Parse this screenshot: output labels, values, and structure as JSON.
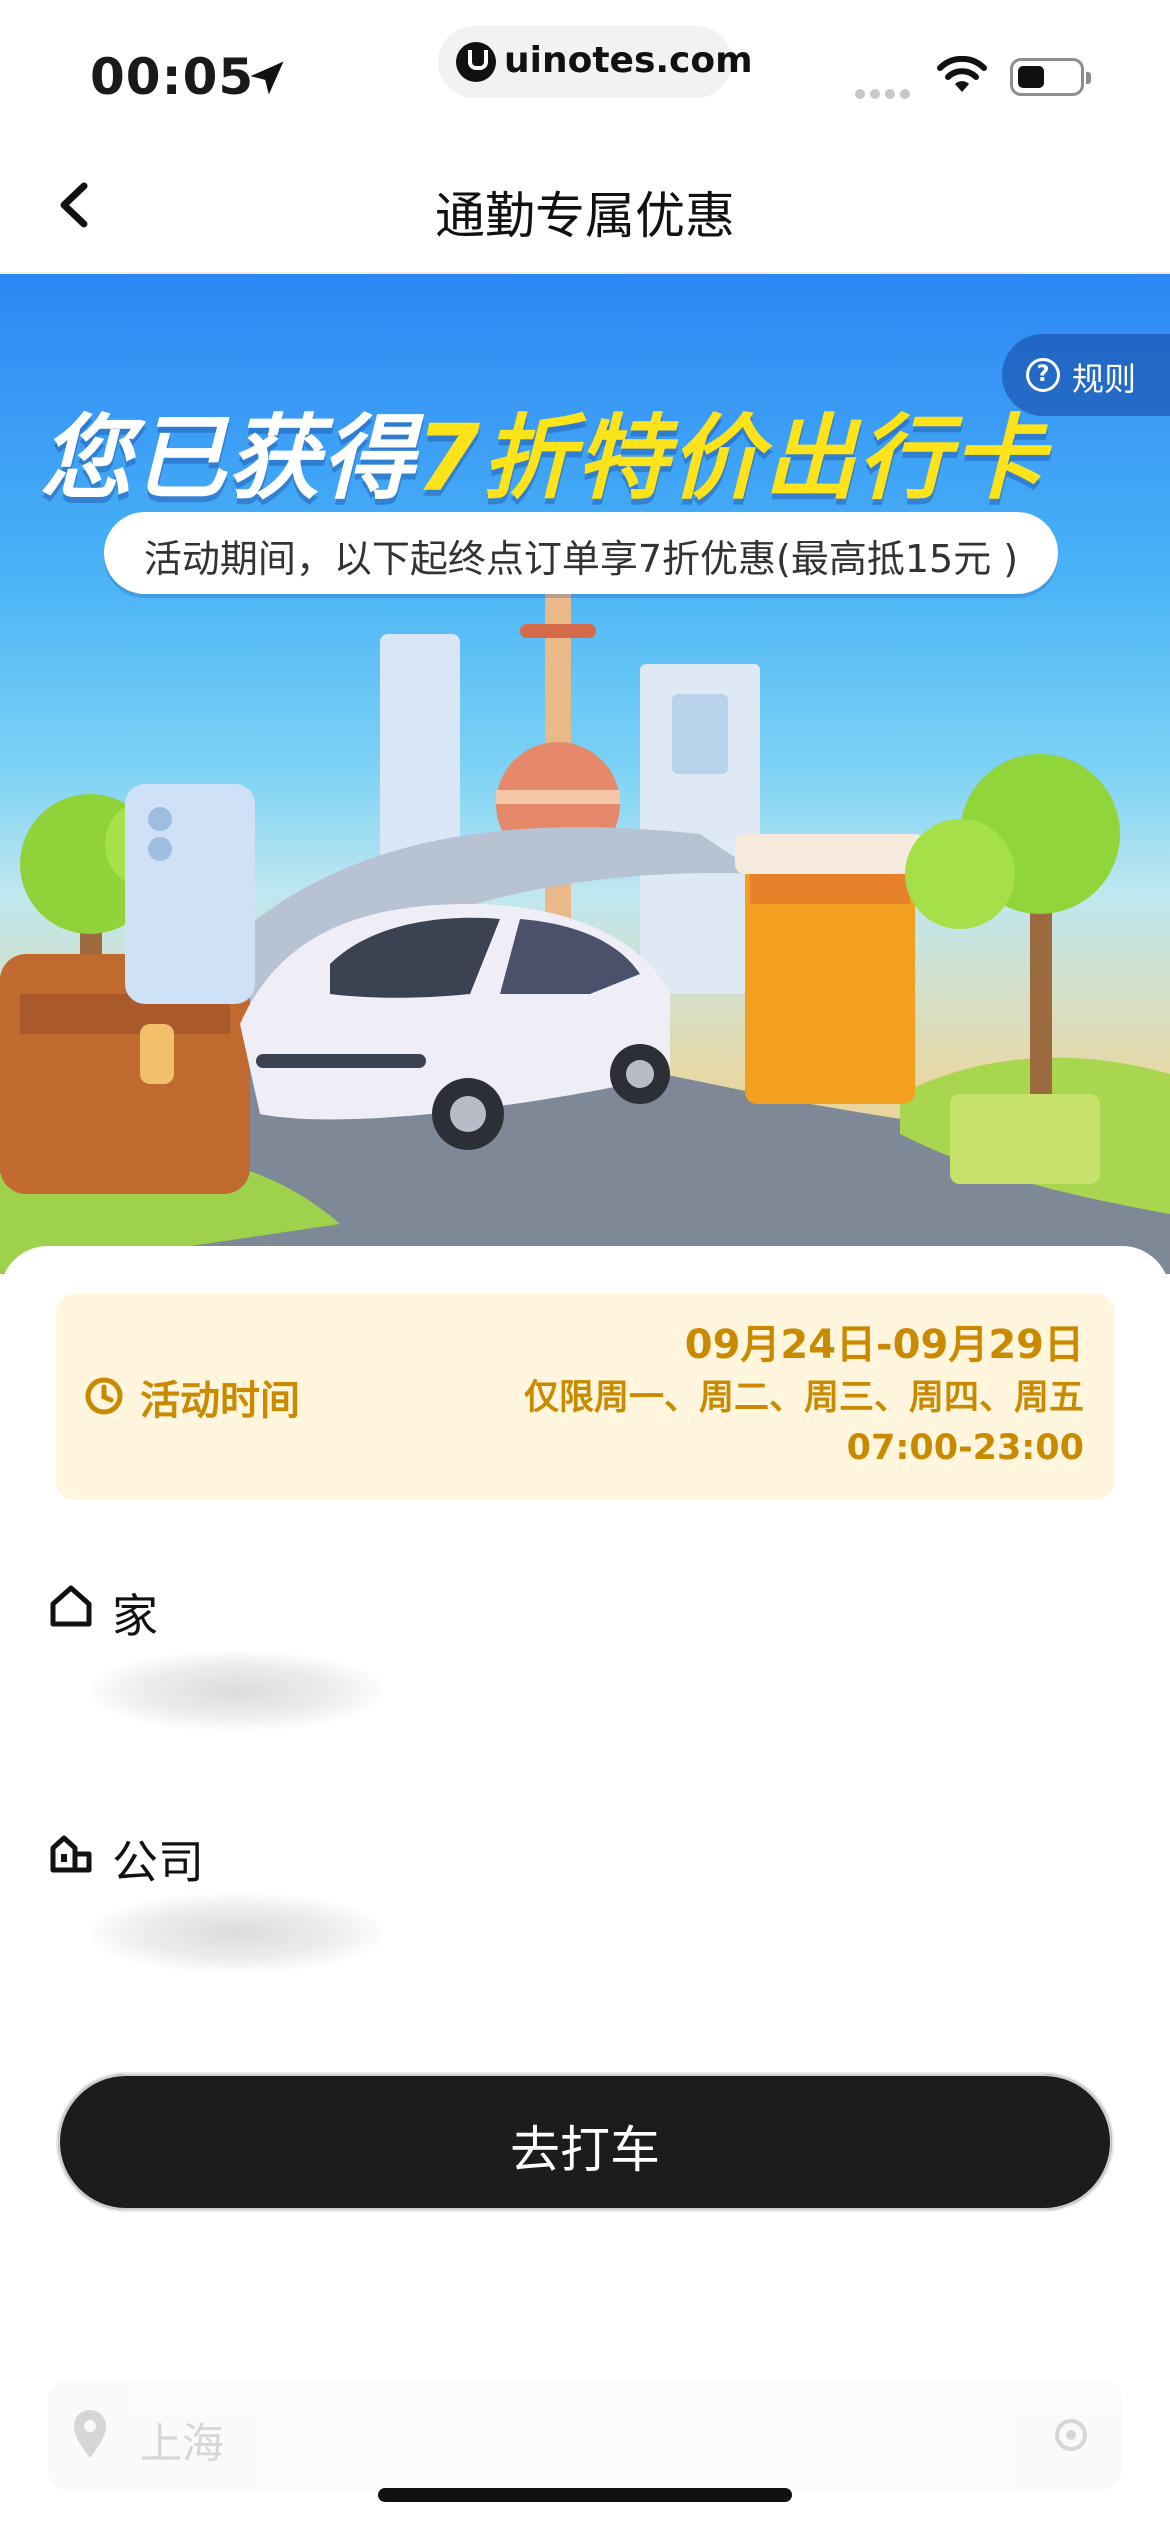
{
  "status_bar": {
    "time": "00:05",
    "domain": "uinotes.com"
  },
  "nav": {
    "title": "通勤专属优惠"
  },
  "banner": {
    "rules_label": "规则",
    "headline_prefix": "您已获得",
    "headline_highlight": "7折特价出行卡",
    "subtitle": "活动期间，以下起终点订单享7折优惠(最高抵15元 )"
  },
  "activity": {
    "label": "活动时间",
    "date_range": "09月24日-09月29日",
    "days": "仅限周一、周二、周三、周四、周五",
    "hours": "07:00-23:00"
  },
  "addresses": [
    {
      "title": "家"
    },
    {
      "title": "公司"
    }
  ],
  "action": {
    "button_label": "去打车"
  },
  "city": {
    "name": "上海"
  },
  "colors": {
    "accent": "#c98a00",
    "activity_bg": "#fff6dd",
    "button_bg": "#1c1c1c",
    "headline_yellow": "#ffe31a"
  }
}
